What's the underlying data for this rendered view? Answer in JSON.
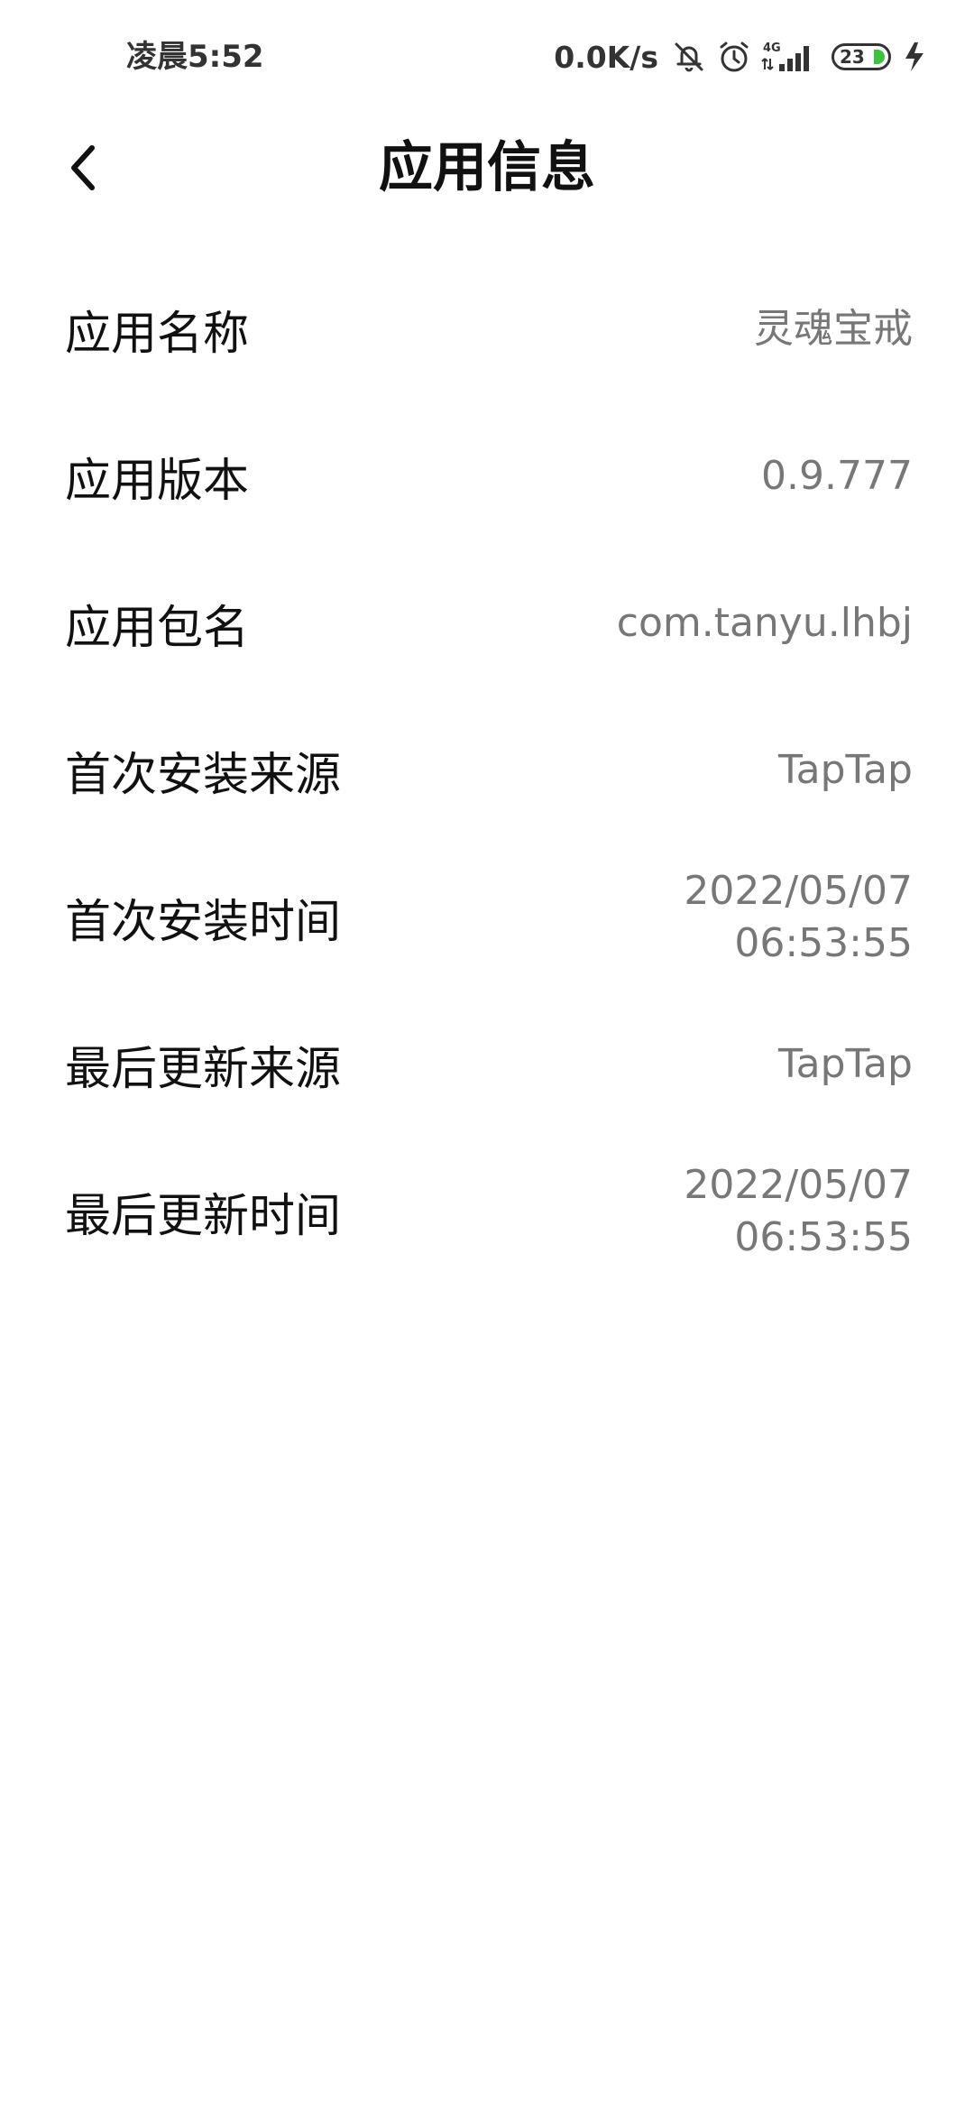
{
  "status_bar": {
    "time": "凌晨5:52",
    "net_speed": "0.0K/s",
    "network_type": "4G",
    "battery_level": "23",
    "icons": [
      "mute-vibrate-icon",
      "alarm-icon",
      "signal-icon",
      "battery-icon",
      "charging-icon"
    ],
    "battery_color": "#3cc23c"
  },
  "header": {
    "title": "应用信息",
    "back_icon": "chevron-left-icon"
  },
  "info": {
    "app_name": {
      "label": "应用名称",
      "value": "灵魂宝戒"
    },
    "app_version": {
      "label": "应用版本",
      "value": "0.9.777"
    },
    "package_name": {
      "label": "应用包名",
      "value": "com.tanyu.lhbj"
    },
    "first_install_source": {
      "label": "首次安装来源",
      "value": "TapTap"
    },
    "first_install_time": {
      "label": "首次安装时间",
      "date": "2022/05/07",
      "time": "06:53:55"
    },
    "last_update_source": {
      "label": "最后更新来源",
      "value": "TapTap"
    },
    "last_update_time": {
      "label": "最后更新时间",
      "date": "2022/05/07",
      "time": "06:53:55"
    }
  }
}
